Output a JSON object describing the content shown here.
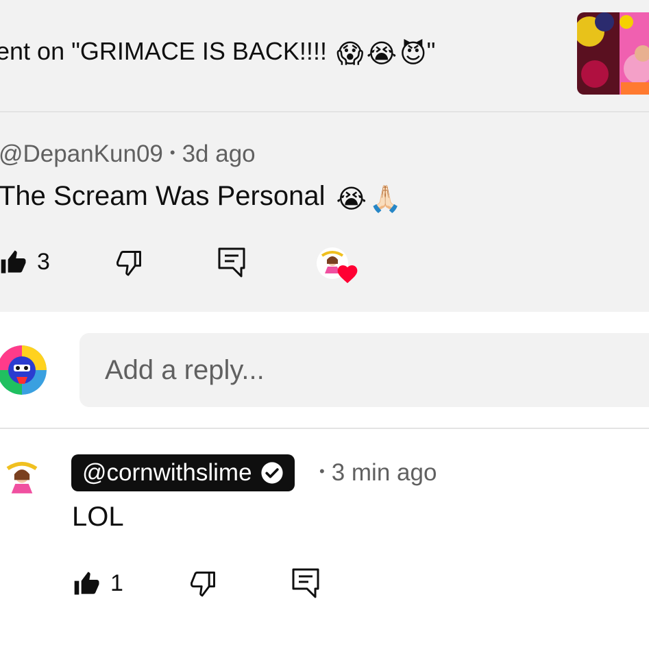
{
  "context": {
    "text": "ent on \"GRIMACE IS BACK!!!! ",
    "emojis": [
      "😱",
      "😭",
      "😈"
    ],
    "closing_quote": "\""
  },
  "comment": {
    "author": "@DepanKun09",
    "time": "3d ago",
    "text": "The Scream Was Personal",
    "emojis": [
      "😭",
      "🙏🏻"
    ],
    "like_count": "3"
  },
  "reply_box": {
    "placeholder": "Add a reply..."
  },
  "reply": {
    "author": "@cornwithslime",
    "time": "3 min ago",
    "text": "LOL",
    "like_count": "1"
  },
  "colors": {
    "band": "#f2f2f2",
    "secondary_text": "#606060",
    "heart": "#ff0033",
    "pill": "#0f0f0f"
  },
  "icons": [
    "thumbs-up-icon",
    "thumbs-down-icon",
    "reply-icon",
    "heart-icon",
    "verified-check-icon"
  ]
}
